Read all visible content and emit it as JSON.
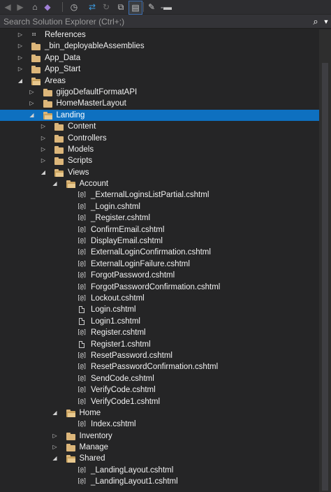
{
  "toolbar": {
    "buttons": [
      {
        "name": "back-button",
        "icon": "back-arrow-icon",
        "glyph": "◀",
        "style": "dim"
      },
      {
        "name": "forward-button",
        "icon": "forward-arrow-icon",
        "glyph": "▶",
        "style": "dim"
      },
      {
        "name": "home-button",
        "icon": "home-icon",
        "glyph": "⌂",
        "style": ""
      },
      {
        "name": "vs-switch-views-button",
        "icon": "visual-studio-icon",
        "glyph": "◆",
        "style": "purple"
      },
      {
        "name": "pending-changes-filter-button",
        "icon": "history-clock-icon",
        "glyph": "◷",
        "style": ""
      },
      {
        "name": "sync-with-active-document-button",
        "icon": "sync-arrows-icon",
        "glyph": "⇄",
        "style": "blue"
      },
      {
        "name": "refresh-button",
        "icon": "refresh-icon",
        "glyph": "↻",
        "style": "dim"
      },
      {
        "name": "collapse-all-button",
        "icon": "collapse-all-icon",
        "glyph": "⧉",
        "style": ""
      },
      {
        "name": "show-all-files-button",
        "icon": "show-all-files-icon",
        "glyph": "▤",
        "style": "sel"
      },
      {
        "name": "properties-button",
        "icon": "wrench-icon",
        "glyph": "✎",
        "style": ""
      },
      {
        "name": "preview-selected-items-button",
        "icon": "preview-minus-icon",
        "glyph": "-▬",
        "style": ""
      }
    ]
  },
  "search": {
    "placeholder": "Search Solution Explorer (Ctrl+;)",
    "icon": "search-icon",
    "dropdown_icon": "chevron-down-icon"
  },
  "tree": [
    {
      "level": 0,
      "state": "collapsed",
      "icon": "references",
      "label": "References"
    },
    {
      "level": 0,
      "state": "collapsed",
      "icon": "folder",
      "label": "_bin_deployableAssemblies"
    },
    {
      "level": 0,
      "state": "collapsed",
      "icon": "folder",
      "label": "App_Data"
    },
    {
      "level": 0,
      "state": "collapsed",
      "icon": "folder",
      "label": "App_Start"
    },
    {
      "level": 0,
      "state": "expanded",
      "icon": "folder-open",
      "label": "Areas"
    },
    {
      "level": 1,
      "state": "collapsed",
      "icon": "folder",
      "label": "gijgoDefaultFormatAPI"
    },
    {
      "level": 1,
      "state": "collapsed",
      "icon": "folder",
      "label": "HomeMasterLayout"
    },
    {
      "level": 1,
      "state": "expanded",
      "icon": "folder-open",
      "label": "Landing",
      "selected": true
    },
    {
      "level": 2,
      "state": "collapsed",
      "icon": "folder",
      "label": "Content"
    },
    {
      "level": 2,
      "state": "collapsed",
      "icon": "folder",
      "label": "Controllers"
    },
    {
      "level": 2,
      "state": "collapsed",
      "icon": "folder",
      "label": "Models"
    },
    {
      "level": 2,
      "state": "collapsed",
      "icon": "folder",
      "label": "Scripts"
    },
    {
      "level": 2,
      "state": "expanded",
      "icon": "folder-open",
      "label": "Views"
    },
    {
      "level": 3,
      "state": "expanded",
      "icon": "folder-open",
      "label": "Account"
    },
    {
      "level": 4,
      "state": "leaf",
      "icon": "cshtml",
      "label": "_ExternalLoginsListPartial.cshtml"
    },
    {
      "level": 4,
      "state": "leaf",
      "icon": "cshtml",
      "label": "_Login.cshtml"
    },
    {
      "level": 4,
      "state": "leaf",
      "icon": "cshtml",
      "label": "_Register.cshtml"
    },
    {
      "level": 4,
      "state": "leaf",
      "icon": "cshtml",
      "label": "ConfirmEmail.cshtml"
    },
    {
      "level": 4,
      "state": "leaf",
      "icon": "cshtml",
      "label": "DisplayEmail.cshtml"
    },
    {
      "level": 4,
      "state": "leaf",
      "icon": "cshtml",
      "label": "ExternalLoginConfirmation.cshtml"
    },
    {
      "level": 4,
      "state": "leaf",
      "icon": "cshtml",
      "label": "ExternalLoginFailure.cshtml"
    },
    {
      "level": 4,
      "state": "leaf",
      "icon": "cshtml",
      "label": "ForgotPassword.cshtml"
    },
    {
      "level": 4,
      "state": "leaf",
      "icon": "cshtml",
      "label": "ForgotPasswordConfirmation.cshtml"
    },
    {
      "level": 4,
      "state": "leaf",
      "icon": "cshtml",
      "label": "Lockout.cshtml"
    },
    {
      "level": 4,
      "state": "leaf",
      "icon": "page",
      "label": "Login.cshtml"
    },
    {
      "level": 4,
      "state": "leaf",
      "icon": "page",
      "label": "Login1.cshtml"
    },
    {
      "level": 4,
      "state": "leaf",
      "icon": "cshtml",
      "label": "Register.cshtml"
    },
    {
      "level": 4,
      "state": "leaf",
      "icon": "page",
      "label": "Register1.cshtml"
    },
    {
      "level": 4,
      "state": "leaf",
      "icon": "cshtml",
      "label": "ResetPassword.cshtml"
    },
    {
      "level": 4,
      "state": "leaf",
      "icon": "cshtml",
      "label": "ResetPasswordConfirmation.cshtml"
    },
    {
      "level": 4,
      "state": "leaf",
      "icon": "cshtml",
      "label": "SendCode.cshtml"
    },
    {
      "level": 4,
      "state": "leaf",
      "icon": "cshtml",
      "label": "VerifyCode.cshtml"
    },
    {
      "level": 4,
      "state": "leaf",
      "icon": "cshtml",
      "label": "VerifyCode1.cshtml"
    },
    {
      "level": 3,
      "state": "expanded",
      "icon": "folder-open",
      "label": "Home"
    },
    {
      "level": 4,
      "state": "leaf",
      "icon": "cshtml",
      "label": "Index.cshtml"
    },
    {
      "level": 3,
      "state": "collapsed",
      "icon": "folder",
      "label": "Inventory"
    },
    {
      "level": 3,
      "state": "collapsed",
      "icon": "folder",
      "label": "Manage"
    },
    {
      "level": 3,
      "state": "expanded",
      "icon": "folder-open",
      "label": "Shared"
    },
    {
      "level": 4,
      "state": "leaf",
      "icon": "cshtml",
      "label": "_LandingLayout.cshtml"
    },
    {
      "level": 4,
      "state": "leaf",
      "icon": "cshtml",
      "label": "_LandingLayout1.cshtml"
    }
  ],
  "colors": {
    "background": "#252526",
    "selection": "#0e70c0",
    "folder": "#dcb67a",
    "text": "#f1f1f1"
  }
}
